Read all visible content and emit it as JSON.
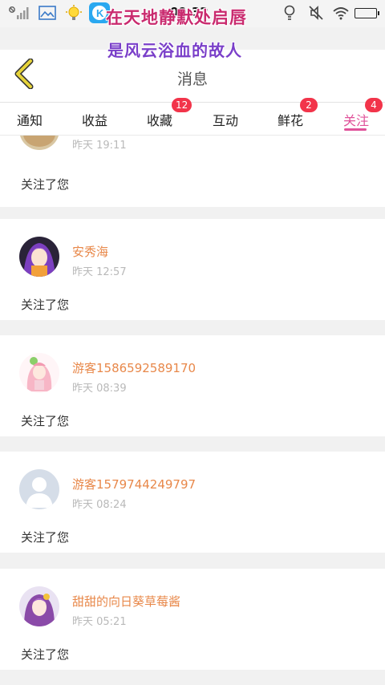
{
  "status_bar": {
    "time": "09:32",
    "icons": [
      "signal-icon",
      "gallery-icon",
      "lightbulb-notification-icon",
      "k-app-icon",
      "idea-icon",
      "mute-icon",
      "wifi-icon",
      "battery-icon"
    ]
  },
  "overlay": {
    "line1": "在天地静默处启唇",
    "line2": "是风云浴血的故人"
  },
  "header": {
    "title": "消息",
    "back_icon": "chevron-left-icon"
  },
  "tabs": [
    {
      "label": "通知",
      "badge": ""
    },
    {
      "label": "收益",
      "badge": ""
    },
    {
      "label": "收藏",
      "badge": "12"
    },
    {
      "label": "互动",
      "badge": ""
    },
    {
      "label": "鲜花",
      "badge": "2"
    },
    {
      "label": "关注",
      "badge": "4",
      "active": true
    }
  ],
  "messages": [
    {
      "name": "",
      "time": "昨天 19:11",
      "text": "关注了您",
      "avatar": "cat-avatar"
    },
    {
      "name": "安秀海",
      "time": "昨天 12:57",
      "text": "关注了您",
      "avatar": "anime-purple-avatar"
    },
    {
      "name": "游客1586592589170",
      "time": "昨天 08:39",
      "text": "关注了您",
      "avatar": "anime-pink-avatar"
    },
    {
      "name": "游客1579744249797",
      "time": "昨天 08:24",
      "text": "关注了您",
      "avatar": "default-avatar"
    },
    {
      "name": "甜甜的向日葵草莓酱",
      "time": "昨天 05:21",
      "text": "关注了您",
      "avatar": "anime-violet-avatar"
    }
  ],
  "colors": {
    "accent": "#e0529a",
    "badge": "#f2344a",
    "name": "#e8884a",
    "back": "#e6d33a"
  }
}
